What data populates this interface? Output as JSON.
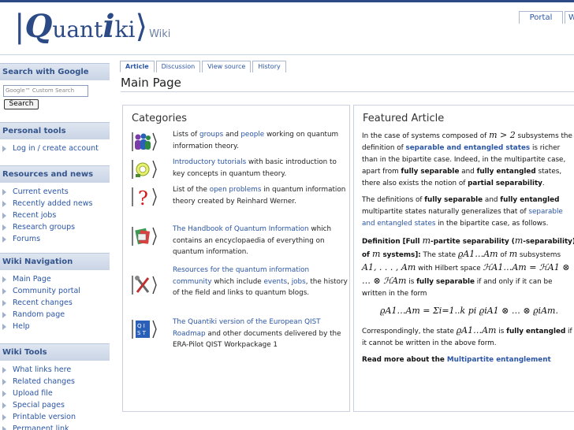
{
  "header": {
    "logo_bracket_open": "|",
    "logo_q": "Q",
    "logo_uant": "uant",
    "logo_i": "i",
    "logo_ki": "ki",
    "logo_bracket_close": "⟩",
    "logo_wiki": "Wiki",
    "portal_tab": "Portal",
    "portal_tab2": "W"
  },
  "sidebar": {
    "search": {
      "title": "Search with Google",
      "placeholder": "Google™ Custom Search",
      "button": "Search"
    },
    "personal": {
      "title": "Personal tools",
      "items": [
        "Log in / create account"
      ]
    },
    "resources": {
      "title": "Resources and news",
      "items": [
        "Current events",
        "Recently added news",
        "Recent jobs",
        "Research groups",
        "Forums"
      ]
    },
    "navigation": {
      "title": "Wiki Navigation",
      "items": [
        "Main Page",
        "Community portal",
        "Recent changes",
        "Random page",
        "Help"
      ]
    },
    "tools": {
      "title": "Wiki Tools",
      "items": [
        "What links here",
        "Related changes",
        "Upload file",
        "Special pages",
        "Printable version",
        "Permanent link"
      ]
    }
  },
  "tabs": [
    "Article",
    "Discussion",
    "View source",
    "History"
  ],
  "page_title": "Main Page",
  "categories": {
    "title": "Categories",
    "items": [
      {
        "icon": "people-icon",
        "pre": "Lists of ",
        "l1": "groups",
        "mid": " and ",
        "l2": "people",
        "post": " working on quantum information theory."
      },
      {
        "icon": "tutorial-icon",
        "l1": "Introductory tutorials",
        "post": " with basic introduction to key concepts in quantum theory."
      },
      {
        "icon": "question-icon",
        "pre": "List of the ",
        "l1": "open problems",
        "post": " in quantum information theory created by Reinhard Werner."
      },
      {
        "icon": "handbook-icon",
        "l1": "The Handbook of Quantum Information",
        "post": " which contains an encyclopaedia of everything on quantum information."
      },
      {
        "icon": "tools-icon",
        "l1": "Resources for the quantum information community",
        "pre2": " which include ",
        "l2": "events",
        "sep": ", ",
        "l3": "jobs",
        "post": ", the history of the field and links to quantum blogs."
      },
      {
        "icon": "qist-icon",
        "l1": "The Quantiki version of the European QIST Roadmap",
        "post": " and other documents delivered by the ERA-Pilot QIST Workpackage 1"
      }
    ]
  },
  "featured": {
    "title": "Featured Article",
    "p1_a": "In the case of systems composed of ",
    "p1_m": "m > 2",
    "p1_b": " subsystems the definition of ",
    "p1_link": "separable and entangled states",
    "p1_c": " is richer than in the bipartite case. Indeed, in the multipartite case, apart from ",
    "p1_b1": "fully separable",
    "p1_d": " and ",
    "p1_b2": "fully entangled",
    "p1_e": " states, there also exists the notion of ",
    "p1_b3": "partial separability",
    "p1_f": ".",
    "p2_a": "The definitions of ",
    "p2_b1": "fully separable",
    "p2_b": " and ",
    "p2_b2": "fully entangled",
    "p2_c": " multipartite states naturally generalizes that of ",
    "p2_link": "separable and entangled states",
    "p2_d": " in the bipartite case, as follows.",
    "def_a": "Definition [Full ",
    "def_m": "m",
    "def_b": "-partite separability (",
    "def_m2": "m",
    "def_c": "-separability) of ",
    "def_m3": "m",
    "def_d": " systems]:",
    "def_e": " The state ",
    "def_rho": "ϱA1…Am",
    "def_f": " of ",
    "def_m4": "m",
    "def_g": " subsystems ",
    "def_sub": "A1, . . . , Am",
    "def_h": " with Hilbert space ",
    "def_h_space": "ℋA1…Am = ℋA1 ⊗ … ⊗ ℋAm",
    "def_i": " is ",
    "def_b_fs": "fully separable",
    "def_j": " if and only if it can be written in the form",
    "formula": "ϱA1…Am = Σi=1..k pi ϱiA1 ⊗ … ⊗ ϱiAm.",
    "p3_a": "Correspondingly, the state ",
    "p3_rho": "ϱA1…Am",
    "p3_b": " is ",
    "p3_b1": "fully entangled",
    "p3_c": " if it cannot be written in the above form.",
    "more_a": "Read more about the ",
    "more_link": "Multipartite entanglement"
  },
  "colors": {
    "accent": "#2c4a86",
    "link": "#2a55a5",
    "sidebar_header": "#c9d4e5"
  }
}
